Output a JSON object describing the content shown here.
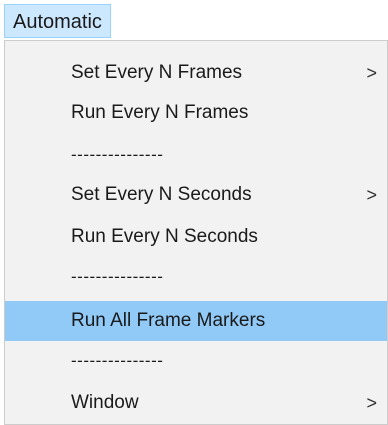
{
  "menubar": {
    "title": "Automatic"
  },
  "menu": {
    "items": [
      {
        "label": "Set Every N Frames",
        "submenu_icon": ">"
      },
      {
        "label": "Run Every N Frames"
      },
      {
        "separator": "---------------"
      },
      {
        "label": "Set Every N Seconds",
        "submenu_icon": ">"
      },
      {
        "label": "Run Every N Seconds"
      },
      {
        "separator": "---------------"
      },
      {
        "label": "Run All Frame Markers"
      },
      {
        "separator": "---------------"
      },
      {
        "label": "Window",
        "submenu_icon": ">"
      }
    ],
    "colors": {
      "highlight": "#91c9f7",
      "menubar_active": "#cce8ff",
      "background": "#f2f2f2"
    }
  }
}
